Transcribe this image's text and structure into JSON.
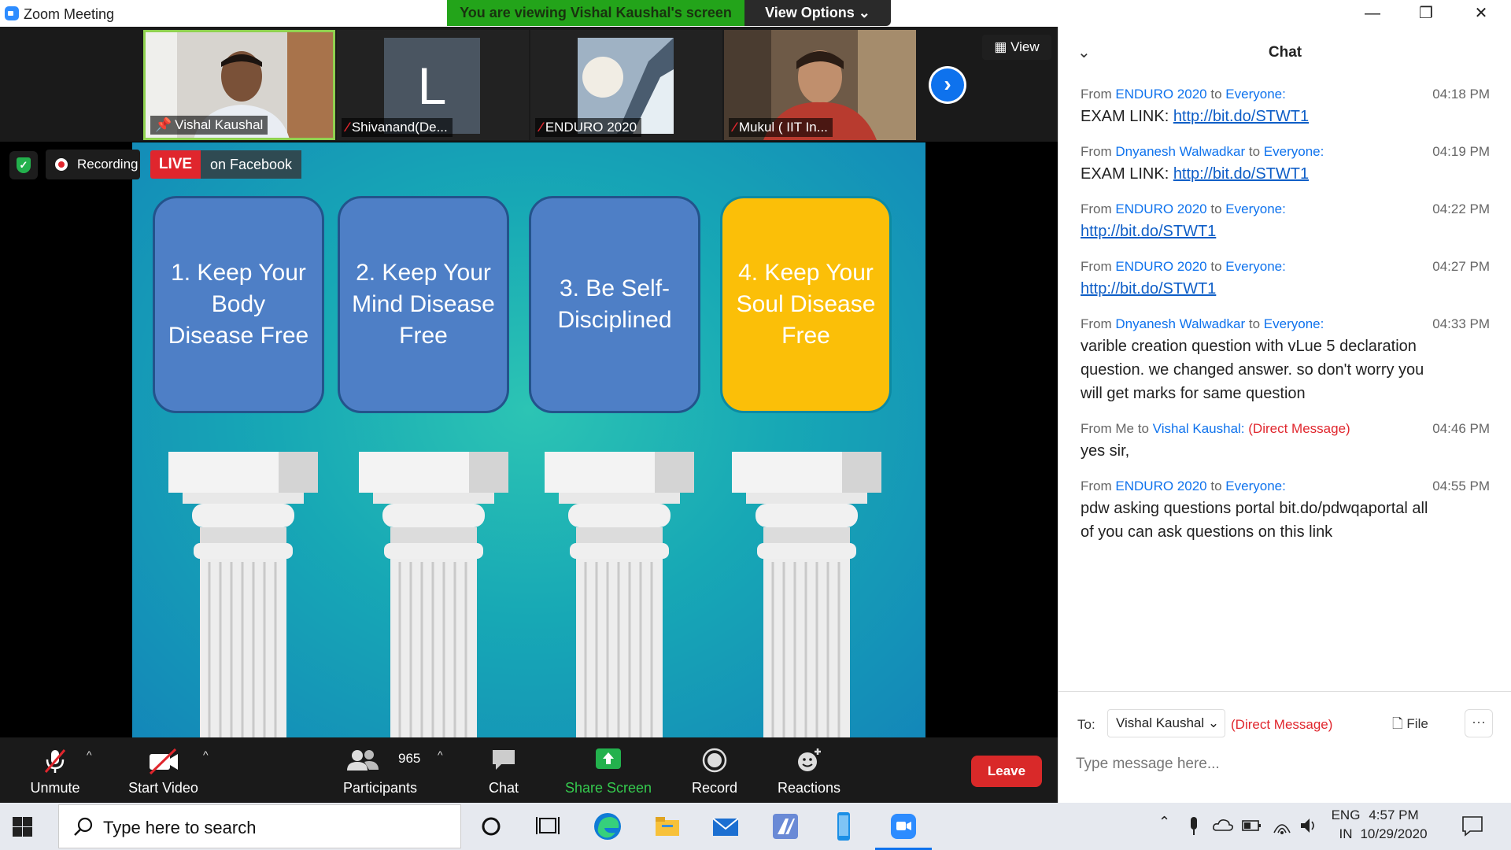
{
  "window": {
    "title": "Zoom Meeting",
    "minimize": "—",
    "maximize": "❐",
    "close": "✕"
  },
  "banner": {
    "viewing": "You are viewing Vishal Kaushal's screen",
    "view_options": "View Options ⌄"
  },
  "participants_strip": [
    {
      "name": "Vishal Kaushal",
      "muted": false,
      "pinned": true
    },
    {
      "name": "Shivanand(De...",
      "muted": true,
      "avatar_letter": "L"
    },
    {
      "name": "ENDURO 2020",
      "muted": true
    },
    {
      "name": "Mukul ( IIT In...",
      "muted": true
    }
  ],
  "view_button": "View",
  "recording": {
    "label": "Recording",
    "live": "LIVE",
    "platform": "on Facebook"
  },
  "slide": {
    "cards": [
      "1. Keep Your Body Disease Free",
      "2. Keep Your Mind Disease Free",
      "3. Be Self-Disciplined",
      "4. Keep Your Soul Disease Free"
    ],
    "colors": {
      "card_blue": "#4e7fc6",
      "card_gold": "#fbbf08"
    }
  },
  "toolbar": {
    "unmute": "Unmute",
    "start_video": "Start Video",
    "participants": "Participants",
    "participants_count": "965",
    "chat": "Chat",
    "share_screen": "Share Screen",
    "record": "Record",
    "reactions": "Reactions",
    "leave": "Leave"
  },
  "chat": {
    "title": "Chat",
    "messages": [
      {
        "from_prefix": "From",
        "from": "ENDURO 2020",
        "to_word": "to",
        "to": "Everyone:",
        "dm": "",
        "time": "04:18 PM",
        "text_prefix": "EXAM LINK: ",
        "link": "http://bit.do/STWT1",
        "text": ""
      },
      {
        "from_prefix": "From",
        "from": "Dnyanesh Walwadkar",
        "to_word": "to",
        "to": "Everyone:",
        "dm": "",
        "time": "04:19 PM",
        "text_prefix": "EXAM LINK: ",
        "link": "http://bit.do/STWT1",
        "text": ""
      },
      {
        "from_prefix": "From",
        "from": "ENDURO 2020",
        "to_word": "to",
        "to": "Everyone:",
        "dm": "",
        "time": "04:22 PM",
        "text_prefix": "",
        "link": "http://bit.do/STWT1",
        "text": ""
      },
      {
        "from_prefix": "From",
        "from": "ENDURO 2020",
        "to_word": "to",
        "to": "Everyone:",
        "dm": "",
        "time": "04:27 PM",
        "text_prefix": "",
        "link": "http://bit.do/STWT1",
        "text": ""
      },
      {
        "from_prefix": "From",
        "from": "Dnyanesh Walwadkar",
        "to_word": "to",
        "to": "Everyone:",
        "dm": "",
        "time": "04:33 PM",
        "text_prefix": "",
        "link": "",
        "text": "varible creation question with vLue 5 declaration question. we changed answer. so don't worry you will get marks for same question"
      },
      {
        "from_prefix": "From Me",
        "from": "",
        "to_word": "to",
        "to": "Vishal Kaushal:",
        "dm": "(Direct Message)",
        "time": "04:46 PM",
        "text_prefix": "",
        "link": "",
        "text": "yes sir,"
      },
      {
        "from_prefix": "From",
        "from": "ENDURO 2020",
        "to_word": "to",
        "to": "Everyone:",
        "dm": "",
        "time": "04:55 PM",
        "text_prefix": "",
        "link": "",
        "text": "pdw asking questions portal bit.do/pdwqaportal all of you can ask questions on this link"
      }
    ],
    "compose": {
      "to_label": "To:",
      "recipient": "Vishal Kaushal",
      "dm_label": "(Direct Message)",
      "file": "File",
      "more": "···",
      "placeholder": "Type message here..."
    }
  },
  "taskbar": {
    "search_placeholder": "Type here to search",
    "lang_top": "ENG",
    "lang_bottom": "IN",
    "time": "4:57 PM",
    "date": "10/29/2020"
  }
}
